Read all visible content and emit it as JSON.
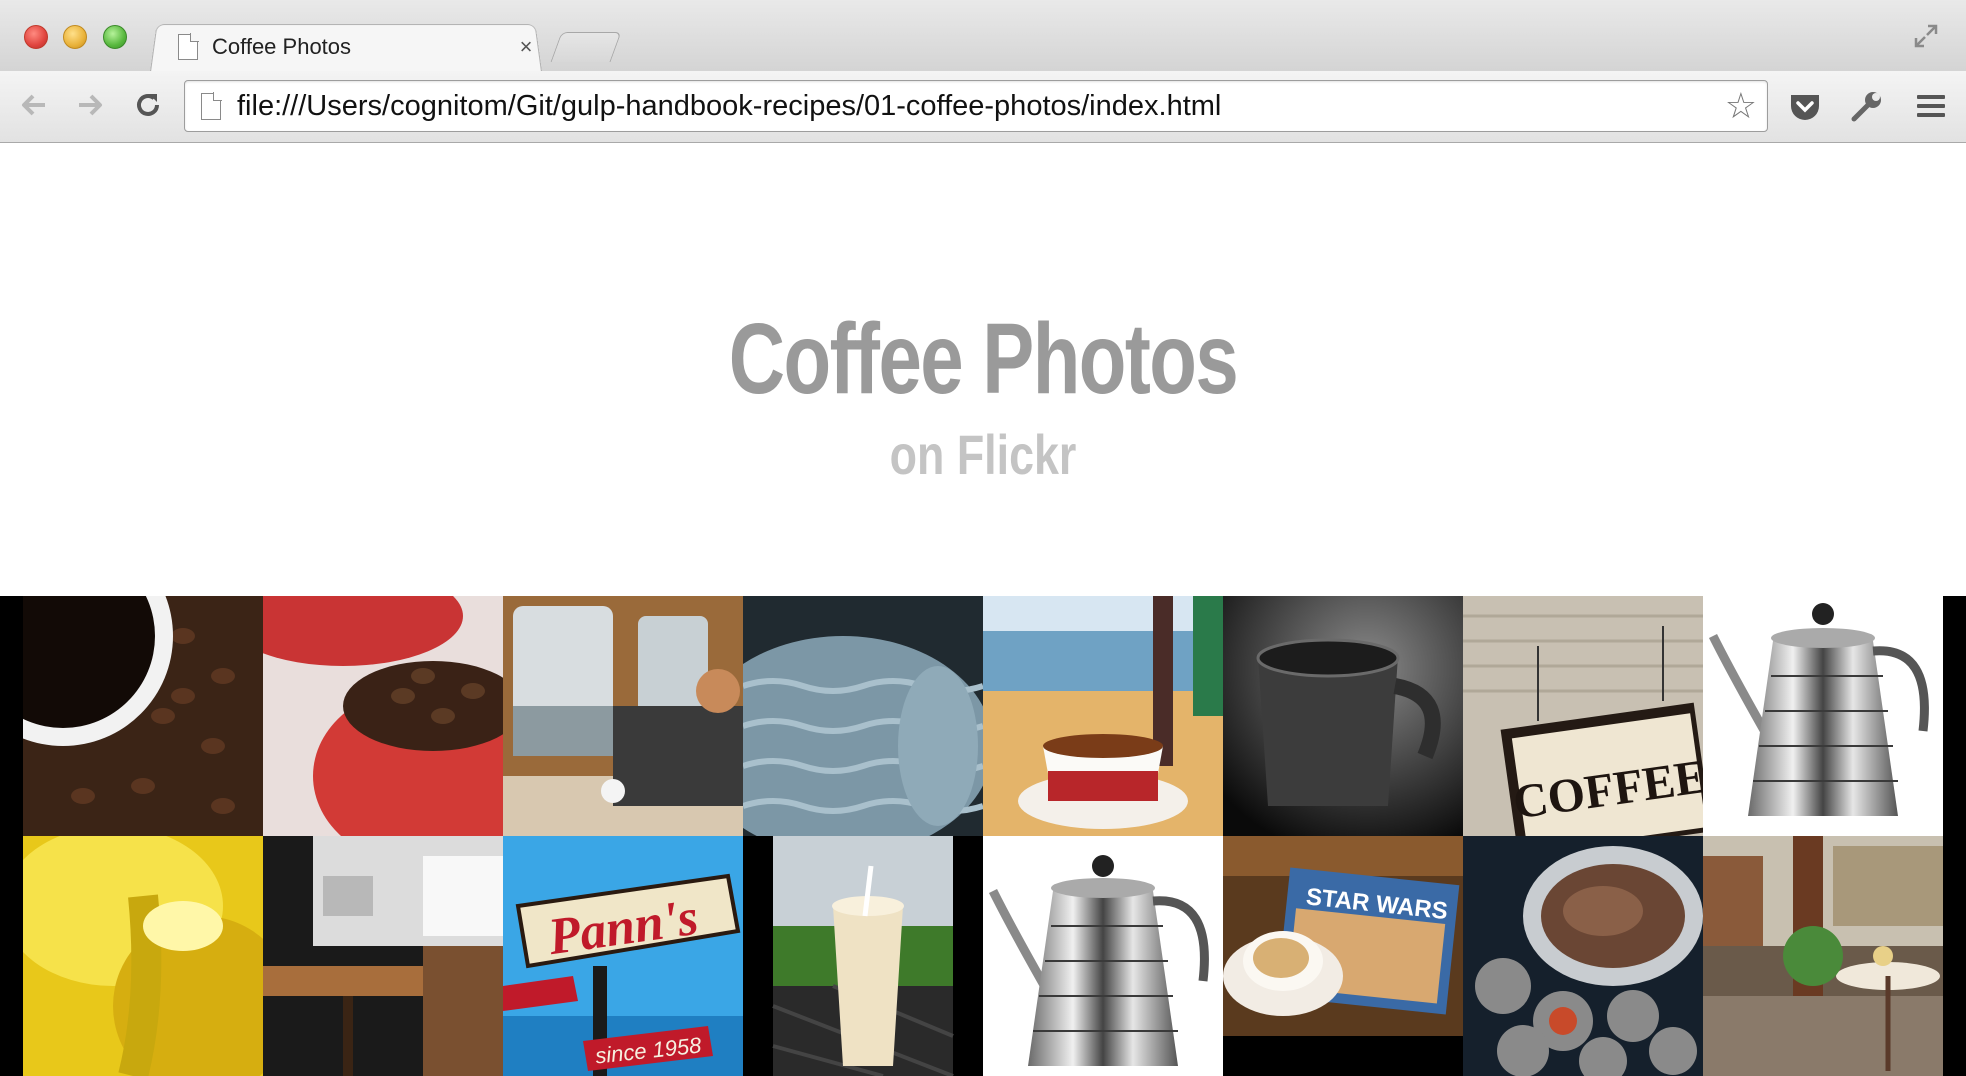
{
  "browser": {
    "tab_title": "Coffee Photos",
    "tab_close": "×",
    "url": "file:///Users/cognitom/Git/gulp-handbook-recipes/01-coffee-photos/index.html",
    "star": "☆"
  },
  "page": {
    "title": "Coffee Photos",
    "subtitle": "on Flickr"
  },
  "gallery": {
    "photos": [
      {
        "subject": "coffee-cup-on-beans-photo"
      },
      {
        "subject": "red-cups-with-beans-photo"
      },
      {
        "subject": "ferry-window-seat-photo"
      },
      {
        "subject": "knitted-texture-photo"
      },
      {
        "subject": "espresso-cup-beach-photo"
      },
      {
        "subject": "grey-mug-photo"
      },
      {
        "subject": "amelia-island-coffee-sign-photo"
      },
      {
        "subject": "steel-kettle-photo"
      },
      {
        "subject": "yellow-flower-photo"
      },
      {
        "subject": "cafe-table-window-photo"
      },
      {
        "subject": "panns-neon-sign-photo"
      },
      {
        "subject": "iced-frappe-photo"
      },
      {
        "subject": "steel-kettle-photo-2"
      },
      {
        "subject": "latte-star-wars-book-photo"
      },
      {
        "subject": "coffee-pot-on-coals-photo"
      },
      {
        "subject": "street-cafe-table-photo"
      }
    ]
  }
}
